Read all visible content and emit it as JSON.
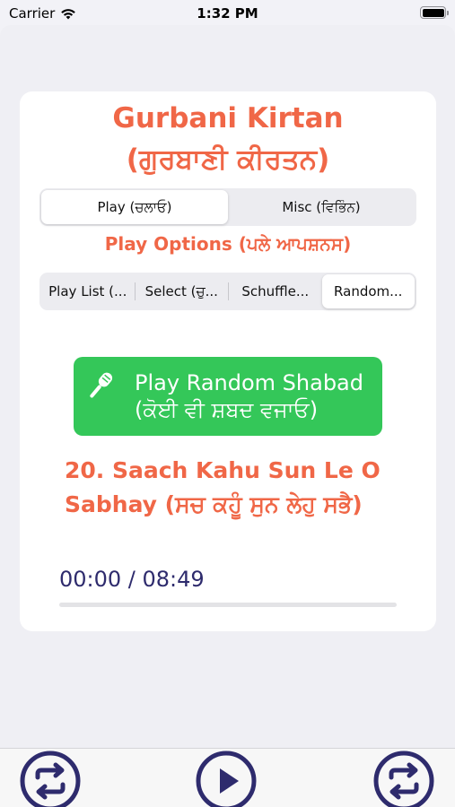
{
  "status": {
    "carrier": "Carrier",
    "time": "1:32 PM"
  },
  "header": {
    "title_line1": "Gurbani Kirtan",
    "title_line2": "(ਗੁਰਬਾਣੀ ਕੀਰਤਨ)"
  },
  "main_tabs": [
    {
      "label": "Play (ਚਲਾਓ)",
      "selected": true
    },
    {
      "label": "Misc (ਵਿਭਿੰਨ)",
      "selected": false
    }
  ],
  "play_options_title": "Play Options (ਪਲੇ ਆਪਸ਼ਨਸ)",
  "play_options": [
    {
      "label": "Play List (...",
      "selected": false
    },
    {
      "label": "Select  (ਚੁ...",
      "selected": false
    },
    {
      "label": "Schuffle...",
      "selected": false
    },
    {
      "label": "Random...",
      "selected": true
    }
  ],
  "play_button": {
    "line1": "Play Random Shabad",
    "line2": "(ਕੋਈ ਵੀ ਸ਼ਬਦ ਵਜਾਓ)",
    "icon": "microphone-icon"
  },
  "track": {
    "title": "20.  Saach Kahu Sun Le O Sabhay (ਸਚ ਕਹੂੰ ਸੁਨ ਲੇਹੁ ਸਭੈ)"
  },
  "player": {
    "time": "00:00 / 08:49",
    "progress": 0
  },
  "bottom_bar": {
    "left_icon": "repeat-icon",
    "center_icon": "play-icon",
    "right_icon": "repeat-icon"
  },
  "colors": {
    "accent": "#f06747",
    "green": "#34c759",
    "navy": "#2e2b6d"
  }
}
